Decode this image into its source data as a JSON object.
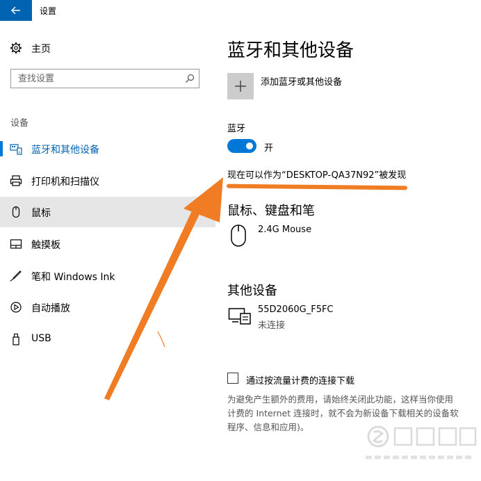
{
  "window": {
    "title": "设置"
  },
  "sidebar": {
    "home_label": "主页",
    "search_placeholder": "查找设置",
    "section_label": "设备",
    "items": [
      {
        "label": "蓝牙和其他设备",
        "icon": "bluetooth-devices-icon"
      },
      {
        "label": "打印机和扫描仪",
        "icon": "printer-icon"
      },
      {
        "label": "鼠标",
        "icon": "mouse-icon"
      },
      {
        "label": "触摸板",
        "icon": "touchpad-icon"
      },
      {
        "label": "笔和 Windows Ink",
        "icon": "pen-icon"
      },
      {
        "label": "自动播放",
        "icon": "autoplay-icon"
      },
      {
        "label": "USB",
        "icon": "usb-icon"
      }
    ]
  },
  "content": {
    "title": "蓝牙和其他设备",
    "add_device_label": "添加蓝牙或其他设备",
    "bluetooth_label": "蓝牙",
    "toggle_state": "开",
    "discoverable_text": "现在可以作为“DESKTOP-QA37N92”被发现",
    "mouse_section_title": "鼠标、键盘和笔",
    "mouse_device_name": "2.4G Mouse",
    "other_section_title": "其他设备",
    "other_device_name": "55D2060G_F5FC",
    "other_device_status": "未连接",
    "metered_label": "通过按流量计费的连接下载",
    "metered_desc_lines": [
      "为避免产生额外的费用，请始终关闭此功能，这样当你使用",
      "计费的 Internet 连接时，就不会为新设备下载相关的设备软",
      "程序、信息和应用)。"
    ]
  },
  "colors": {
    "accent": "#0078d7",
    "title_bar_button": "#0063b1",
    "annotation_arrow": "#f07c24",
    "selected_row": "#e6e6e6"
  }
}
